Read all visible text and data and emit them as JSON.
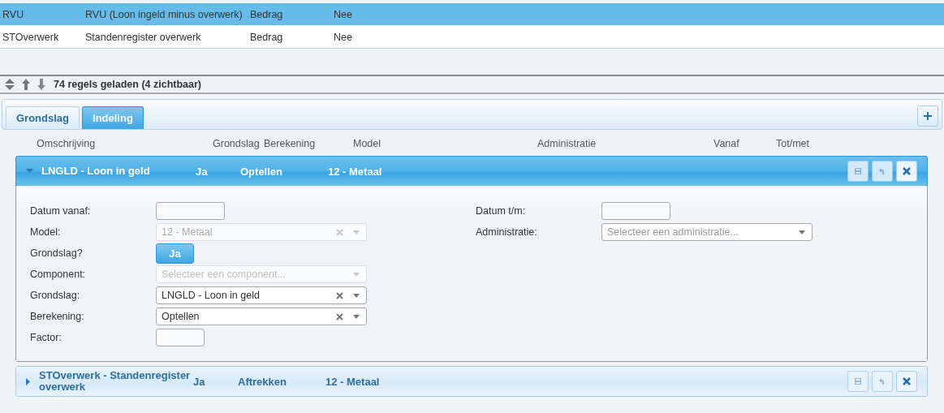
{
  "grid": {
    "rows": [
      {
        "selected": true,
        "cells": [
          "RVU",
          "RVU (Loon ingeld minus overwerk)",
          "Bedrag",
          "Nee"
        ]
      },
      {
        "selected": false,
        "cells": [
          "STOverwerk",
          "Standenregister overwerk",
          "Bedrag",
          "Nee"
        ]
      }
    ]
  },
  "status_bar": {
    "text": "74 regels geladen (4 zichtbaar)"
  },
  "tabs": [
    {
      "label": "Grondslag",
      "selected": false
    },
    {
      "label": "Indeling",
      "selected": true
    }
  ],
  "columns": [
    "Omschrijving",
    "Grondslag",
    "Berekening",
    "Model",
    "Administratie",
    "Vanaf",
    "Tot/met"
  ],
  "panels": [
    {
      "expanded": true,
      "title": "LNGLD - Loon in geld",
      "grondslag": "Ja",
      "berekening": "Optellen",
      "model": "12 - Metaal",
      "left_fields": [
        {
          "kind": "date",
          "label": "Datum vanaf:"
        },
        {
          "kind": "select",
          "label": "Model:",
          "value": "12 - Metaal",
          "disabled": true
        },
        {
          "kind": "toggle",
          "label": "Grondslag?",
          "value": "Ja",
          "on": true
        },
        {
          "kind": "select",
          "label": "Component:",
          "placeholder": "Selecteer een component...",
          "disabled": true
        },
        {
          "kind": "select",
          "label": "Grondslag:",
          "value": "LNGLD - Loon in geld",
          "disabled": false
        },
        {
          "kind": "select",
          "label": "Berekening:",
          "value": "Optellen",
          "disabled": false
        },
        {
          "kind": "number",
          "label": "Factor:"
        }
      ],
      "right_fields": [
        {
          "kind": "date",
          "label": "Datum t/m:"
        },
        {
          "kind": "select",
          "label": "Administratie:",
          "placeholder": "Selecteer een administratie...",
          "disabled": false
        }
      ]
    },
    {
      "expanded": false,
      "title": "STOverwerk - Standenregister overwerk",
      "grondslag": "Ja",
      "berekening": "Aftrekken",
      "model": "12 - Metaal"
    }
  ]
}
